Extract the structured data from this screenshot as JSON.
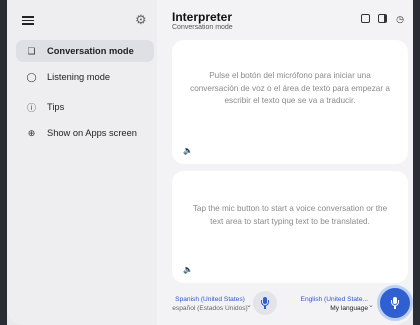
{
  "sidebar": {
    "items": [
      {
        "label": "Conversation mode",
        "icon": "conversation-icon",
        "active": true
      },
      {
        "label": "Listening mode",
        "icon": "listening-icon",
        "active": false
      },
      {
        "label": "Tips",
        "icon": "info-icon",
        "active": false
      },
      {
        "label": "Show on Apps screen",
        "icon": "add-circle-icon",
        "active": false
      }
    ]
  },
  "header": {
    "title": "Interpreter",
    "subtitle": "Conversation mode"
  },
  "top_card": {
    "text": "Pulse el botón del micrófono para iniciar una conversación de voz o el área de texto para empezar a escribir el texto que se va a traducir."
  },
  "bottom_card": {
    "text": "Tap the mic button to start a voice conversation or the text area to start typing text to be translated."
  },
  "languages": {
    "left_name": "Spanish (United States)",
    "left_sub": "español (Estados Unidos)",
    "right_name": "English (United State...",
    "right_sub": "My language"
  },
  "colors": {
    "accent": "#2f5fd1",
    "card": "#ffffff",
    "background": "#f3f3f5"
  }
}
